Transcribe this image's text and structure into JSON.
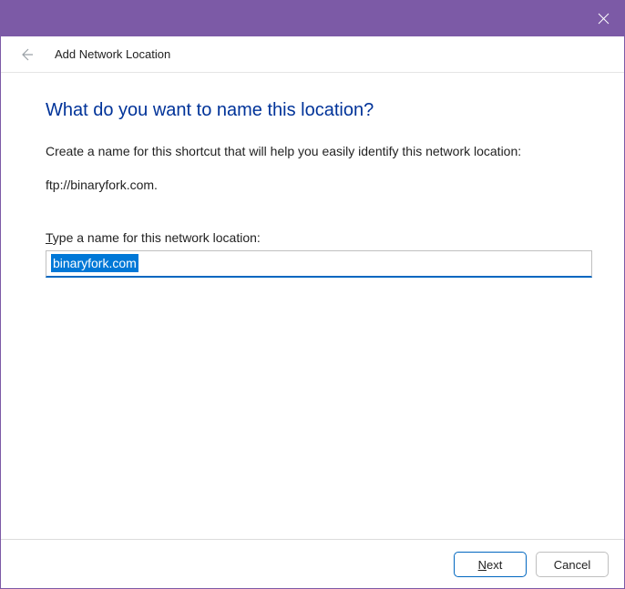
{
  "titlebar": {
    "close_label": "Close"
  },
  "header": {
    "title": "Add Network Location"
  },
  "main": {
    "heading": "What do you want to name this location?",
    "description": "Create a name for this shortcut that will help you easily identify this network location:",
    "location": "ftp://binaryfork.com.",
    "field_label_prefix": "T",
    "field_label_rest": "ype a name for this network location:",
    "field_value": "binaryfork.com"
  },
  "footer": {
    "next_prefix": "N",
    "next_rest": "ext",
    "cancel_label": "Cancel"
  }
}
